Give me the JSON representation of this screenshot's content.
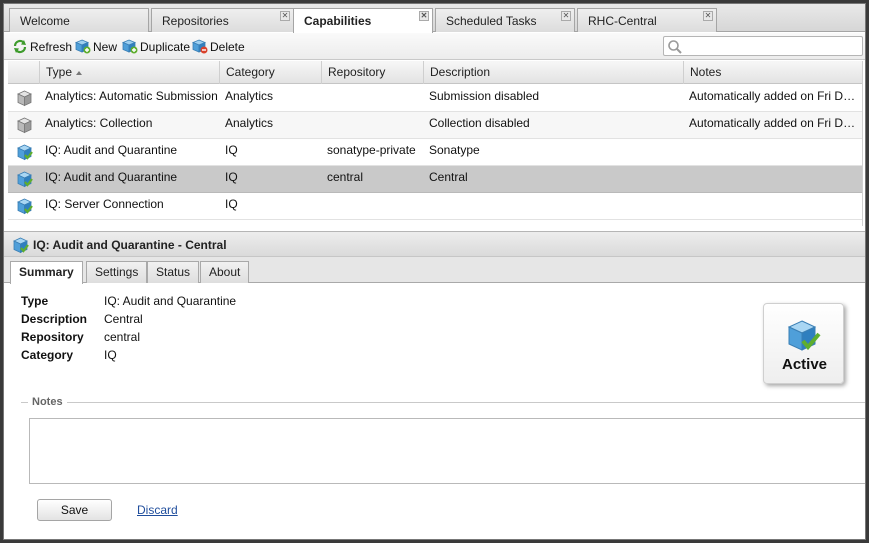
{
  "tabs": [
    {
      "label": "Welcome",
      "active": false,
      "closable": false
    },
    {
      "label": "Repositories",
      "active": false,
      "closable": true
    },
    {
      "label": "Capabilities",
      "active": true,
      "closable": true
    },
    {
      "label": "Scheduled Tasks",
      "active": false,
      "closable": true
    },
    {
      "label": "RHC-Central",
      "active": false,
      "closable": true
    }
  ],
  "toolbar": {
    "refresh_label": "Refresh",
    "new_label": "New",
    "duplicate_label": "Duplicate",
    "delete_label": "Delete",
    "search_value": ""
  },
  "grid": {
    "columns": [
      "Type",
      "Category",
      "Repository",
      "Description",
      "Notes"
    ],
    "sort_column": "Type",
    "sort_direction": "ascending",
    "rows": [
      {
        "icon": "gray-cube-icon",
        "type": "Analytics: Automatic Submission",
        "category": "Analytics",
        "repository": "",
        "description": "Submission disabled",
        "notes": "Automatically added on Fri Dec ...",
        "selected": false
      },
      {
        "icon": "gray-cube-icon",
        "type": "Analytics: Collection",
        "category": "Analytics",
        "repository": "",
        "description": "Collection disabled",
        "notes": "Automatically added on Fri Dec ...",
        "selected": false
      },
      {
        "icon": "blue-cube-check-icon",
        "type": "IQ: Audit and Quarantine",
        "category": "IQ",
        "repository": "sonatype-private",
        "description": "Sonatype",
        "notes": "",
        "selected": false
      },
      {
        "icon": "blue-cube-check-icon",
        "type": "IQ: Audit and Quarantine",
        "category": "IQ",
        "repository": "central",
        "description": "Central",
        "notes": "",
        "selected": true
      },
      {
        "icon": "blue-cube-check-icon",
        "type": "IQ: Server Connection",
        "category": "IQ",
        "repository": "",
        "description": "",
        "notes": "",
        "selected": false
      }
    ]
  },
  "detail": {
    "title": "IQ: Audit and Quarantine - Central",
    "tabs": [
      "Summary",
      "Settings",
      "Status",
      "About"
    ],
    "active_tab": "Summary",
    "summary": {
      "type_label": "Type",
      "type_value": "IQ: Audit and Quarantine",
      "description_label": "Description",
      "description_value": "Central",
      "repository_label": "Repository",
      "repository_value": "central",
      "category_label": "Category",
      "category_value": "IQ"
    },
    "status": "Active",
    "notes_legend": "Notes",
    "notes_value": "",
    "save_label": "Save",
    "discard_label": "Discard"
  },
  "colors": {
    "selected_row": "#c9c9c9",
    "link": "#1f4d9c",
    "cube_blue": "#4f9fd9",
    "check_green": "#5fae2e"
  }
}
